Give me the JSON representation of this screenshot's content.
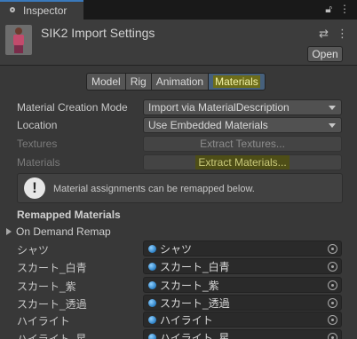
{
  "tab": {
    "title": "Inspector"
  },
  "header": {
    "title": "SIK2 Import Settings",
    "open_label": "Open"
  },
  "toolbar": {
    "tabs": [
      "Model",
      "Rig",
      "Animation",
      "Materials"
    ],
    "active": "Materials"
  },
  "props": {
    "material_creation_mode": {
      "label": "Material Creation Mode",
      "value": "Import via MaterialDescription"
    },
    "location": {
      "label": "Location",
      "value": "Use Embedded Materials"
    },
    "textures": {
      "label": "Textures",
      "button": "Extract Textures..."
    },
    "materials": {
      "label": "Materials",
      "button": "Extract Materials..."
    }
  },
  "help": {
    "text": "Material assignments can be remapped below."
  },
  "remapped": {
    "title": "Remapped Materials",
    "on_demand": "On Demand Remap",
    "rows": [
      {
        "label": "シャツ",
        "value": "シャツ"
      },
      {
        "label": "スカート_白青",
        "value": "スカート_白青"
      },
      {
        "label": "スカート_紫",
        "value": "スカート_紫"
      },
      {
        "label": "スカート_透過",
        "value": "スカート_透過"
      },
      {
        "label": "ハイライト",
        "value": "ハイライト"
      },
      {
        "label": "ハイライト_星",
        "value": "ハイライト_星"
      }
    ]
  },
  "colors": {
    "accent": "#3a79bb",
    "highlight": "#6d6d1a",
    "background": "#383838"
  }
}
